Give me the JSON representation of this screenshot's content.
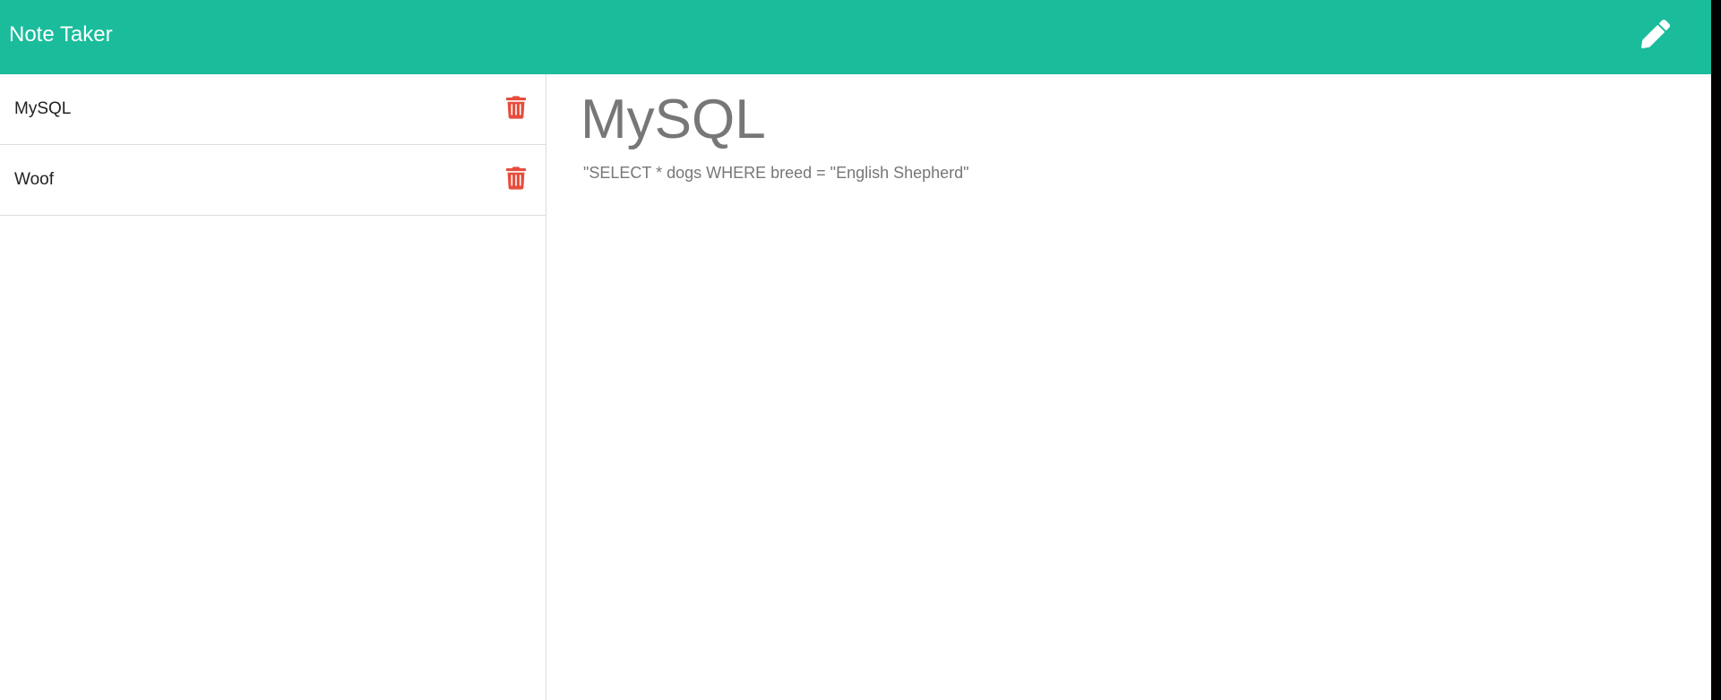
{
  "app": {
    "brand": "Note Taker",
    "new_note_icon": "pencil-icon"
  },
  "colors": {
    "navbar": "#1abc9c",
    "delete_icon": "#e74c3c",
    "note_text": "#777777"
  },
  "sidebar": {
    "notes": [
      {
        "title": "MySQL",
        "delete_icon": "trash-icon"
      },
      {
        "title": "Woof",
        "delete_icon": "trash-icon"
      }
    ]
  },
  "main": {
    "note_title": "MySQL",
    "note_text": "\"SELECT * dogs WHERE breed = \"English Shepherd\""
  }
}
